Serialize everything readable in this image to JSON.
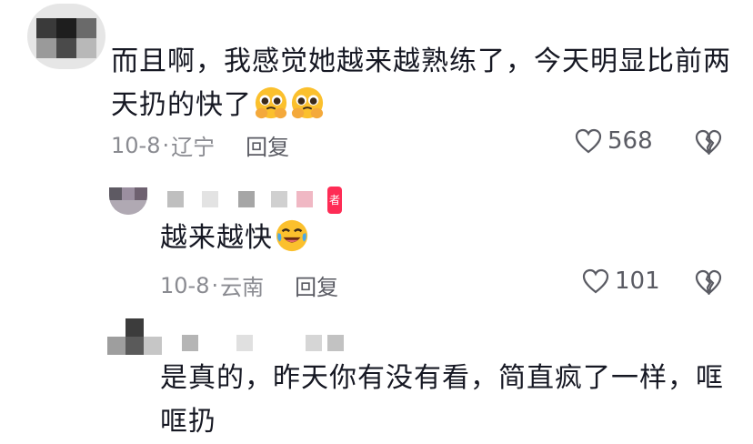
{
  "comments": [
    {
      "text_line1": "而且啊，我感觉她越来越熟练了，今天明显比前两",
      "text_line2": "天扔的快了",
      "date": "10-8",
      "location": "辽宁",
      "reply_label": "回复",
      "likes": "568",
      "emoji": "pleading-face-hands"
    },
    {
      "badge": "者",
      "text": "越来越快",
      "date": "10-8",
      "location": "云南",
      "reply_label": "回复",
      "likes": "101",
      "emoji": "laughing-crying-face"
    },
    {
      "text_line1": "是真的，昨天你有没有看，简直疯了一样，哐",
      "text_line2": "哐扔"
    }
  ],
  "colors": {
    "text": "#161823",
    "meta": "#8a8b91",
    "accent": "#fe2c55"
  }
}
